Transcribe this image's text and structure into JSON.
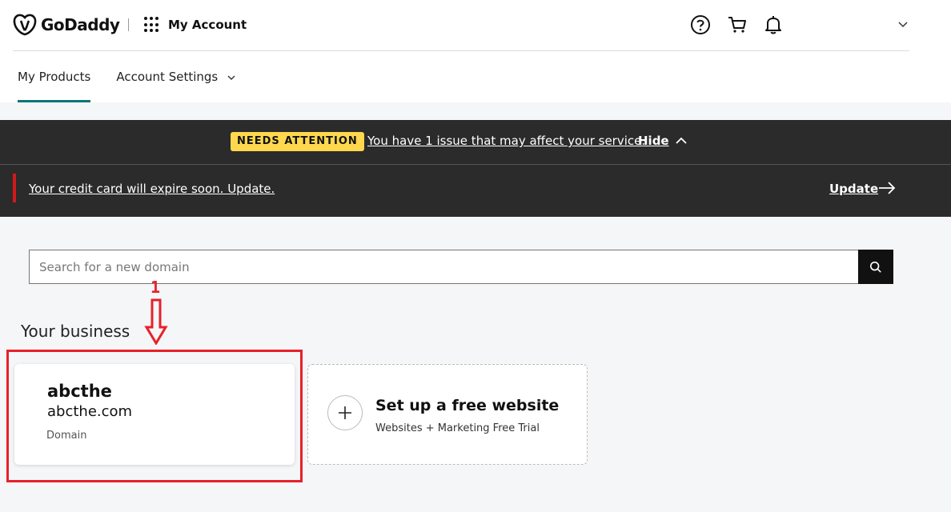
{
  "header": {
    "logo_text": "GoDaddy",
    "app_label": "My Account"
  },
  "nav": {
    "tabs": [
      {
        "label": "My Products",
        "active": true
      },
      {
        "label": "Account Settings",
        "active": false
      }
    ]
  },
  "alert": {
    "badge": "NEEDS ATTENTION",
    "issue_text": "You have 1 issue that may affect your service.",
    "hide_label": "Hide",
    "message": "Your credit card will expire soon. Update.",
    "update_label": "Update"
  },
  "search": {
    "placeholder": "Search for a new domain"
  },
  "annotation": {
    "label": "1",
    "color": "#e8202a"
  },
  "business": {
    "section_title": "Your business",
    "card": {
      "name": "abcthe",
      "domain": "abcthe.com",
      "type": "Domain"
    },
    "website_card": {
      "title": "Set up a free website",
      "subtitle": "Websites + Marketing Free Trial"
    }
  },
  "colors": {
    "accent": "#09757a",
    "badge": "#ffd84d",
    "banner": "#2b2b2b",
    "alert_bar": "#d21a1a"
  }
}
